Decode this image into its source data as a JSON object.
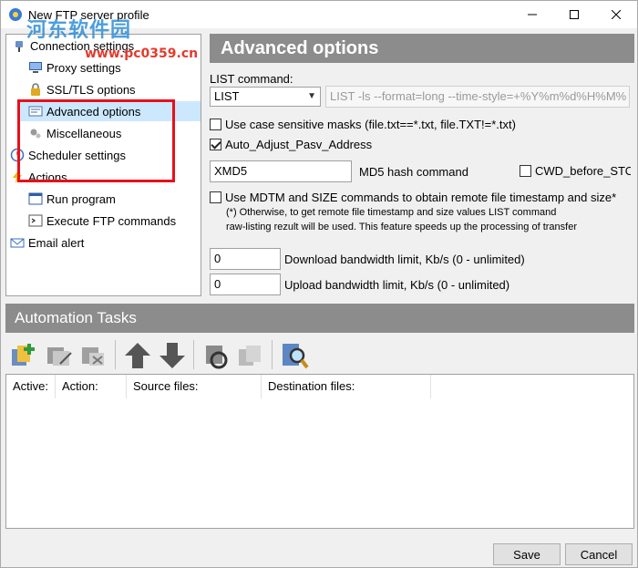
{
  "window": {
    "title": "New FTP server profile",
    "watermark_text": "河东软件园",
    "watermark_url": "www.pc0359.cn"
  },
  "tree": {
    "items": [
      {
        "label": "Connection settings",
        "icon": "plug-icon"
      },
      {
        "label": "Proxy settings",
        "icon": "monitor-icon"
      },
      {
        "label": "SSL/TLS options",
        "icon": "lock-icon"
      },
      {
        "label": "Advanced options",
        "icon": "window-list-icon"
      },
      {
        "label": "Miscellaneous",
        "icon": "gears-icon"
      },
      {
        "label": "Scheduler settings",
        "icon": "clock-icon"
      },
      {
        "label": "Actions",
        "icon": "lightning-icon"
      },
      {
        "label": "Run program",
        "icon": "run-icon"
      },
      {
        "label": "Execute FTP commands",
        "icon": "terminal-icon"
      },
      {
        "label": "Email alert",
        "icon": "envelope-icon"
      }
    ]
  },
  "panel": {
    "title": "Advanced options",
    "list_command_label": "LIST command:",
    "list_command_selected": "LIST",
    "list_command_value": "LIST -ls --format=long --time-style=+%Y%m%d%H%M%",
    "case_sensitive_label": "Use case sensitive masks (file.txt==*.txt, file.TXT!=*.txt)",
    "auto_adjust_label": "Auto_Adjust_Pasv_Address",
    "md5_value": "XMD5",
    "md5_label": "MD5 hash command",
    "cwd_label": "CWD_before_STOR",
    "mdtm_label": "Use MDTM and SIZE commands to obtain remote file timestamp and size*",
    "note_line1": "(*) Otherwise, to get remote file timestamp and size values LIST command",
    "note_line2": "raw-listing rezult will be used. This feature speeds up the processing of transfer",
    "download_value": "0",
    "download_label": "Download bandwidth limit, Kb/s (0 - unlimited)",
    "upload_value": "0",
    "upload_label": "Upload bandwidth limit, Kb/s (0 - unlimited)"
  },
  "automation": {
    "title": "Automation Tasks",
    "columns": [
      "Active:",
      "Action:",
      "Source files:",
      "Destination files:"
    ]
  },
  "buttons": {
    "save": "Save",
    "cancel": "Cancel"
  },
  "colors": {
    "header_bg": "#8c8c8c",
    "selection": "#cce8ff",
    "highlight_box": "#e8101a"
  }
}
